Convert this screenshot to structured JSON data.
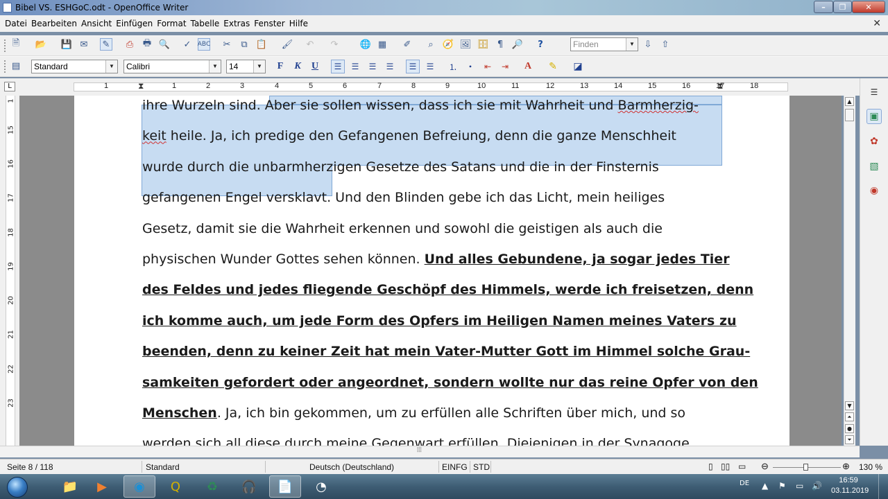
{
  "window": {
    "title": "Bibel VS. ESHGoC.odt - OpenOffice Writer"
  },
  "menu": [
    "Datei",
    "Bearbeiten",
    "Ansicht",
    "Einfügen",
    "Format",
    "Tabelle",
    "Extras",
    "Fenster",
    "Hilfe"
  ],
  "toolbar": {
    "find_placeholder": "Finden"
  },
  "format": {
    "style": "Standard",
    "font": "Calibri",
    "size": "14",
    "bold": "F",
    "italic": "K",
    "underline": "U"
  },
  "ruler": {
    "marks": [
      "1",
      "1",
      "2",
      "3",
      "4",
      "5",
      "6",
      "7",
      "8",
      "9",
      "10",
      "11",
      "12",
      "13",
      "14",
      "15",
      "16",
      "17",
      "18"
    ]
  },
  "vruler": {
    "marks": [
      "1",
      "15",
      "16",
      "17",
      "18",
      "19",
      "20",
      "21",
      "22",
      "23"
    ]
  },
  "document": {
    "lines": [
      {
        "parts": [
          {
            "t": "ihre Wurzeln sind. ",
            "s": "n"
          },
          {
            "t": "Aber sie sollen wissen, dass ich sie mit Wahrheit und ",
            "s": "n"
          },
          {
            "t": "Barmherzig-",
            "s": "sq"
          }
        ]
      },
      {
        "parts": [
          {
            "t": "keit",
            "s": "sq"
          },
          {
            "t": " heile. Ja, ich predige den Gefangenen Befreiung, denn die ganze Menschheit",
            "s": "n"
          }
        ]
      },
      {
        "parts": [
          {
            "t": "wurde durch die unbarmherzigen Gesetze des Satans und die in der Finsternis",
            "s": "n"
          }
        ]
      },
      {
        "parts": [
          {
            "t": "gefangenen Engel versklavt.",
            "s": "n"
          },
          {
            "t": " Und den Blinden gebe ich das Licht, mein heiliges",
            "s": "n"
          }
        ]
      },
      {
        "parts": [
          {
            "t": "Gesetz, damit sie die Wahrheit erkennen und sowohl die geistigen als auch die",
            "s": "n"
          }
        ]
      },
      {
        "parts": [
          {
            "t": "physischen Wunder Gottes sehen können. ",
            "s": "n"
          },
          {
            "t": "Und alles Gebundene, ja sogar jedes Tier",
            "s": "b"
          }
        ]
      },
      {
        "parts": [
          {
            "t": "des Feldes und jedes fliegende Geschöpf des Himmels, werde ich freisetzen, denn",
            "s": "b"
          }
        ]
      },
      {
        "parts": [
          {
            "t": "ich komme auch, um jede Form des Opfers im Heiligen Namen meines Vaters zu",
            "s": "b"
          }
        ]
      },
      {
        "parts": [
          {
            "t": "beenden, denn zu keiner Zeit hat mein Vater-Mutter Gott im Himmel solche Grau-",
            "s": "b"
          }
        ]
      },
      {
        "parts": [
          {
            "t": "samkeiten gefordert oder angeordnet, sondern wollte nur das reine Opfer von den",
            "s": "b"
          }
        ]
      },
      {
        "parts": [
          {
            "t": "Menschen",
            "s": "b"
          },
          {
            "t": ". Ja, ich bin gekommen, um zu erfüllen alle Schriften über mich, und so",
            "s": "n"
          }
        ]
      },
      {
        "parts": [
          {
            "t": "werden sich all diese durch meine Gegenwart erfüllen. Diejenigen in der Synagoge",
            "s": "n"
          }
        ]
      }
    ]
  },
  "status": {
    "page": "Seite 8 / 118",
    "style": "Standard",
    "language": "Deutsch (Deutschland)",
    "mode1": "EINFG",
    "mode2": "STD",
    "zoom": "130 %"
  },
  "taskbar": {
    "lang": "DE",
    "time": "16:59",
    "date": "03.11.2019"
  }
}
